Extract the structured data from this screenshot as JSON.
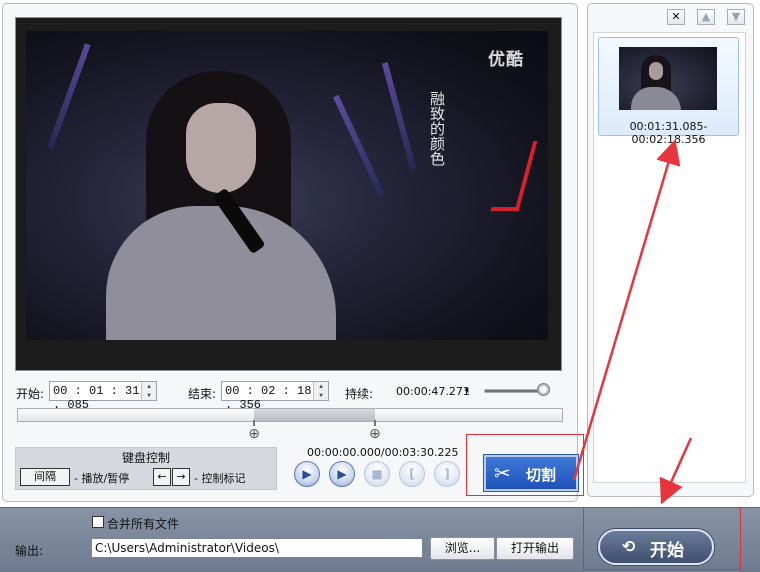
{
  "video": {
    "watermark": "优酷",
    "overlay_text": "融致的颜色"
  },
  "controls": {
    "start_label": "开始:",
    "start_value": "00 : 01 : 31 . 085",
    "end_label": "结束:",
    "end_value": "00 : 02 : 18 . 356",
    "duration_label": "持续:",
    "duration_value": "00:00:47.271",
    "volume_level": 0.85,
    "position_readout": "00:00:00.000/00:03:30.225",
    "selection_start_fraction": 0.434,
    "selection_end_fraction": 0.656
  },
  "keyboard": {
    "title": "键盘控制",
    "space_key": "间隔",
    "space_desc": "- 播放/暂停",
    "arrow_left": "←",
    "arrow_right": "→",
    "arrow_desc": "- 控制标记"
  },
  "cut_button": {
    "label": "切割"
  },
  "clips": [
    {
      "label": "00:01:31.085-00:02:18.356"
    }
  ],
  "side_buttons": {
    "delete": "✕",
    "up": "▲",
    "down": "▼"
  },
  "output": {
    "merge_label": "合并所有文件",
    "label": "输出:",
    "path": "C:\\Users\\Administrator\\Videos\\",
    "browse": "浏览...",
    "open": "打开输出"
  },
  "start_button": {
    "label": "开始"
  }
}
